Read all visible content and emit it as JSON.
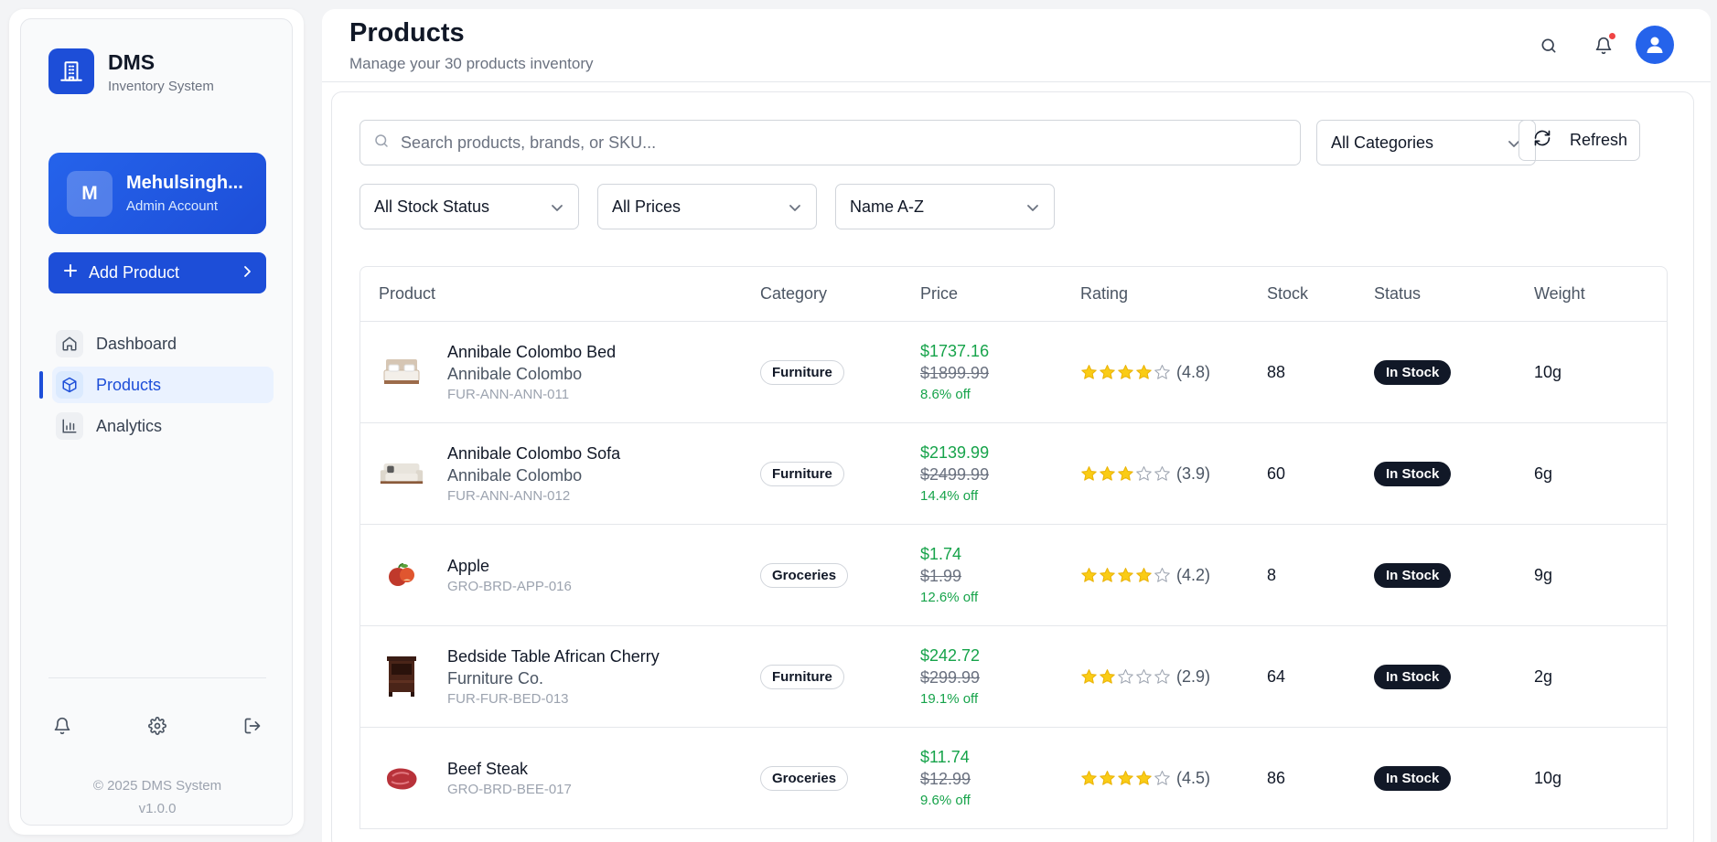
{
  "brand": {
    "name": "DMS",
    "subtitle": "Inventory System"
  },
  "user": {
    "initial": "M",
    "name": "Mehulsingh...",
    "role": "Admin Account"
  },
  "sidebar": {
    "add_product_label": "Add Product",
    "nav": [
      {
        "label": "Dashboard",
        "icon": "home-icon",
        "active": false
      },
      {
        "label": "Products",
        "icon": "box-icon",
        "active": true
      },
      {
        "label": "Analytics",
        "icon": "bar-chart-icon",
        "active": false
      }
    ],
    "footer_icons": [
      "bell-icon",
      "gear-icon",
      "logout-icon"
    ],
    "copyright": "© 2025 DMS System",
    "version": "v1.0.0"
  },
  "header": {
    "title": "Products",
    "subtitle": "Manage your 30 products inventory",
    "icons": [
      "search-icon",
      "bell-icon",
      "user-avatar-icon"
    ],
    "notification_dot_color": "#ef4444"
  },
  "filters": {
    "search_placeholder": "Search products, brands, or SKU...",
    "category": "All Categories",
    "refresh_label": "Refresh",
    "stock_status": "All Stock Status",
    "prices": "All Prices",
    "sort": "Name A-Z"
  },
  "table": {
    "columns": [
      "Product",
      "Category",
      "Price",
      "Rating",
      "Stock",
      "Status",
      "Weight"
    ],
    "rows": [
      {
        "name": "Annibale Colombo Bed",
        "brand": "Annibale Colombo",
        "sku": "FUR-ANN-ANN-011",
        "category": "Furniture",
        "price": "$1737.16",
        "old_price": "$1899.99",
        "discount": "8.6% off",
        "stars": 4,
        "rating": "(4.8)",
        "stock": "88",
        "status": "In Stock",
        "weight": "10g",
        "thumb": "bed-icon"
      },
      {
        "name": "Annibale Colombo Sofa",
        "brand": "Annibale Colombo",
        "sku": "FUR-ANN-ANN-012",
        "category": "Furniture",
        "price": "$2139.99",
        "old_price": "$2499.99",
        "discount": "14.4% off",
        "stars": 3,
        "rating": "(3.9)",
        "stock": "60",
        "status": "In Stock",
        "weight": "6g",
        "thumb": "sofa-icon"
      },
      {
        "name": "Apple",
        "brand": "",
        "sku": "GRO-BRD-APP-016",
        "category": "Groceries",
        "price": "$1.74",
        "old_price": "$1.99",
        "discount": "12.6% off",
        "stars": 4,
        "rating": "(4.2)",
        "stock": "8",
        "status": "In Stock",
        "weight": "9g",
        "thumb": "apple-icon"
      },
      {
        "name": "Bedside Table African Cherry",
        "brand": "Furniture Co.",
        "sku": "FUR-FUR-BED-013",
        "category": "Furniture",
        "price": "$242.72",
        "old_price": "$299.99",
        "discount": "19.1% off",
        "stars": 2,
        "rating": "(2.9)",
        "stock": "64",
        "status": "In Stock",
        "weight": "2g",
        "thumb": "bedside-table-icon"
      },
      {
        "name": "Beef Steak",
        "brand": "",
        "sku": "GRO-BRD-BEE-017",
        "category": "Groceries",
        "price": "$11.74",
        "old_price": "$12.99",
        "discount": "9.6% off",
        "stars": 4,
        "rating": "(4.5)",
        "stock": "86",
        "status": "In Stock",
        "weight": "10g",
        "thumb": "steak-icon"
      }
    ]
  },
  "colors": {
    "accent": "#1d4ed8",
    "price_green": "#16a34a",
    "star": "#facc15",
    "status_bg": "#111827"
  }
}
